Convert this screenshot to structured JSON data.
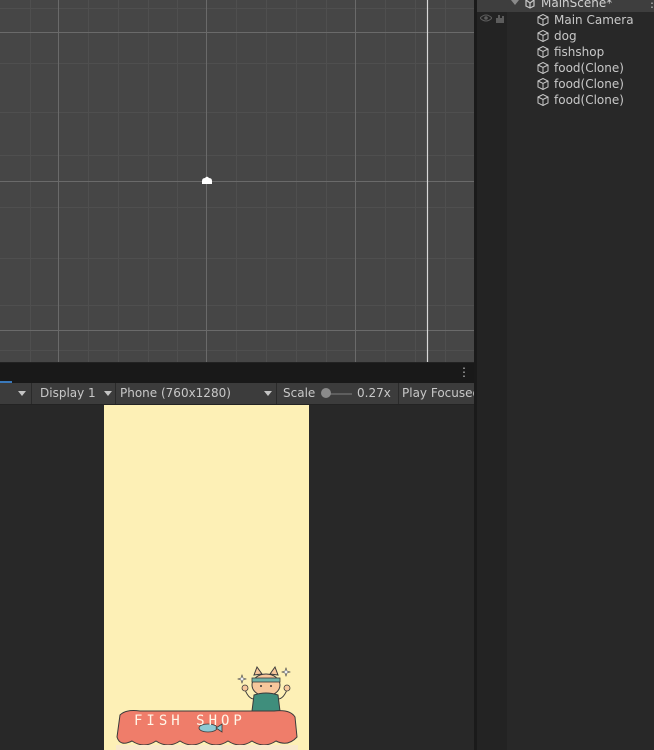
{
  "game_toolbar": {
    "display": "Display 1",
    "resolution": "Phone (760x1280)",
    "scale_label": "Scale",
    "scale_value": "0.27x",
    "play_mode": "Play Focused"
  },
  "game": {
    "shop_sign": "FISH SHOP",
    "background_color": "#fdf0b6",
    "awning_color": "#ef7d6a"
  },
  "hierarchy": {
    "scene_name": "MainScene*",
    "items": [
      {
        "label": "Main Camera"
      },
      {
        "label": "dog"
      },
      {
        "label": "fishshop"
      },
      {
        "label": "food(Clone)"
      },
      {
        "label": "food(Clone)"
      },
      {
        "label": "food(Clone)"
      }
    ]
  },
  "icons": [
    "scene-icon",
    "gameobject-cube-icon",
    "visibility-eye-icon",
    "pickable-hand-icon",
    "camera-gizmo-icon",
    "more-options-icon"
  ],
  "colors": {
    "accent": "#3a79bb",
    "scene_bg": "#464646",
    "panel_bg": "#282828"
  }
}
